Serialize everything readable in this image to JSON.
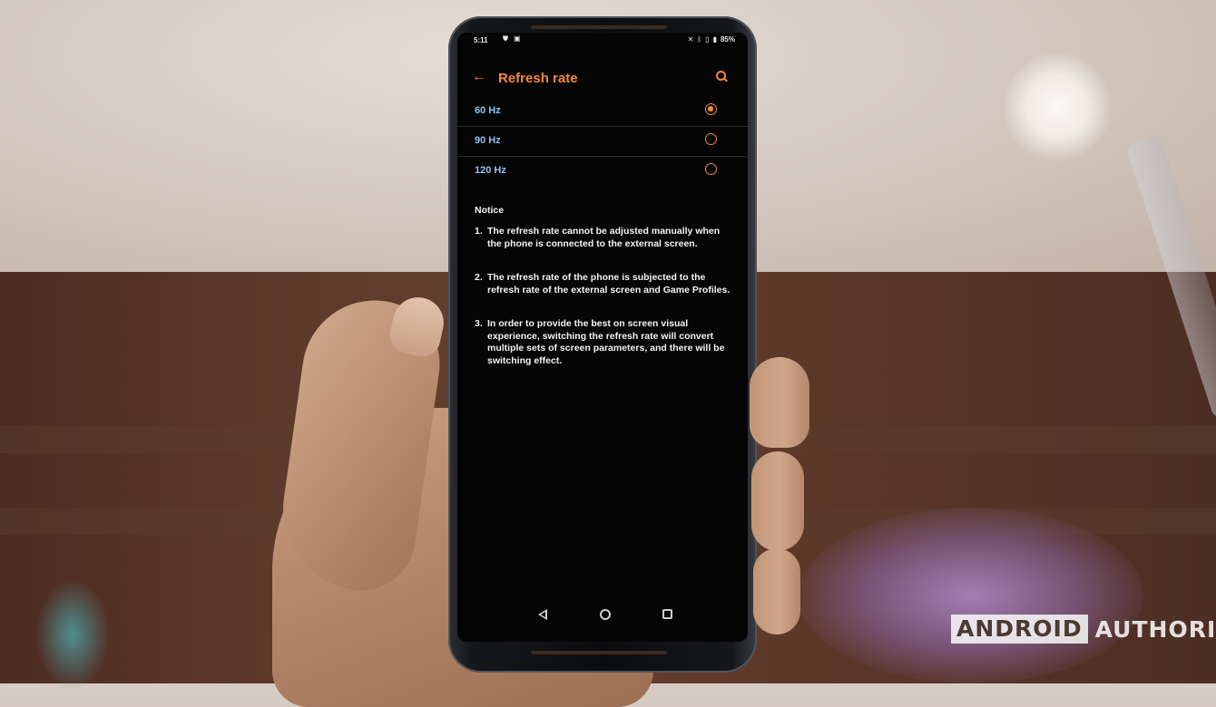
{
  "status_bar": {
    "time": "5:11",
    "battery": "85%"
  },
  "app_bar": {
    "title": "Refresh rate",
    "back_icon": "arrow-left-icon",
    "search_icon": "search-icon"
  },
  "options": [
    {
      "label": "60 Hz",
      "selected": true
    },
    {
      "label": "90 Hz",
      "selected": false
    },
    {
      "label": "120 Hz",
      "selected": false
    }
  ],
  "notice": {
    "title": "Notice",
    "items": [
      {
        "num": "1.",
        "text": "The refresh rate cannot be adjusted manually when the phone is connected to the external screen."
      },
      {
        "num": "2.",
        "text": "The refresh rate of the phone is subjected to the refresh rate of the external screen and Game Profiles."
      },
      {
        "num": "3.",
        "text": "In order to provide the best on screen visual experience, switching the refresh rate will convert multiple sets of screen parameters, and there will be switching effect."
      }
    ]
  },
  "nav_bar": {
    "back_icon": "nav-back-icon",
    "home_icon": "nav-home-icon",
    "recents_icon": "nav-recents-icon"
  },
  "watermark": {
    "brand_box": "ANDROID",
    "brand_text": "AUTHORITY"
  },
  "colors": {
    "accent": "#f4883a",
    "option_text": "#8fc3f0",
    "screen_bg": "#050505"
  }
}
